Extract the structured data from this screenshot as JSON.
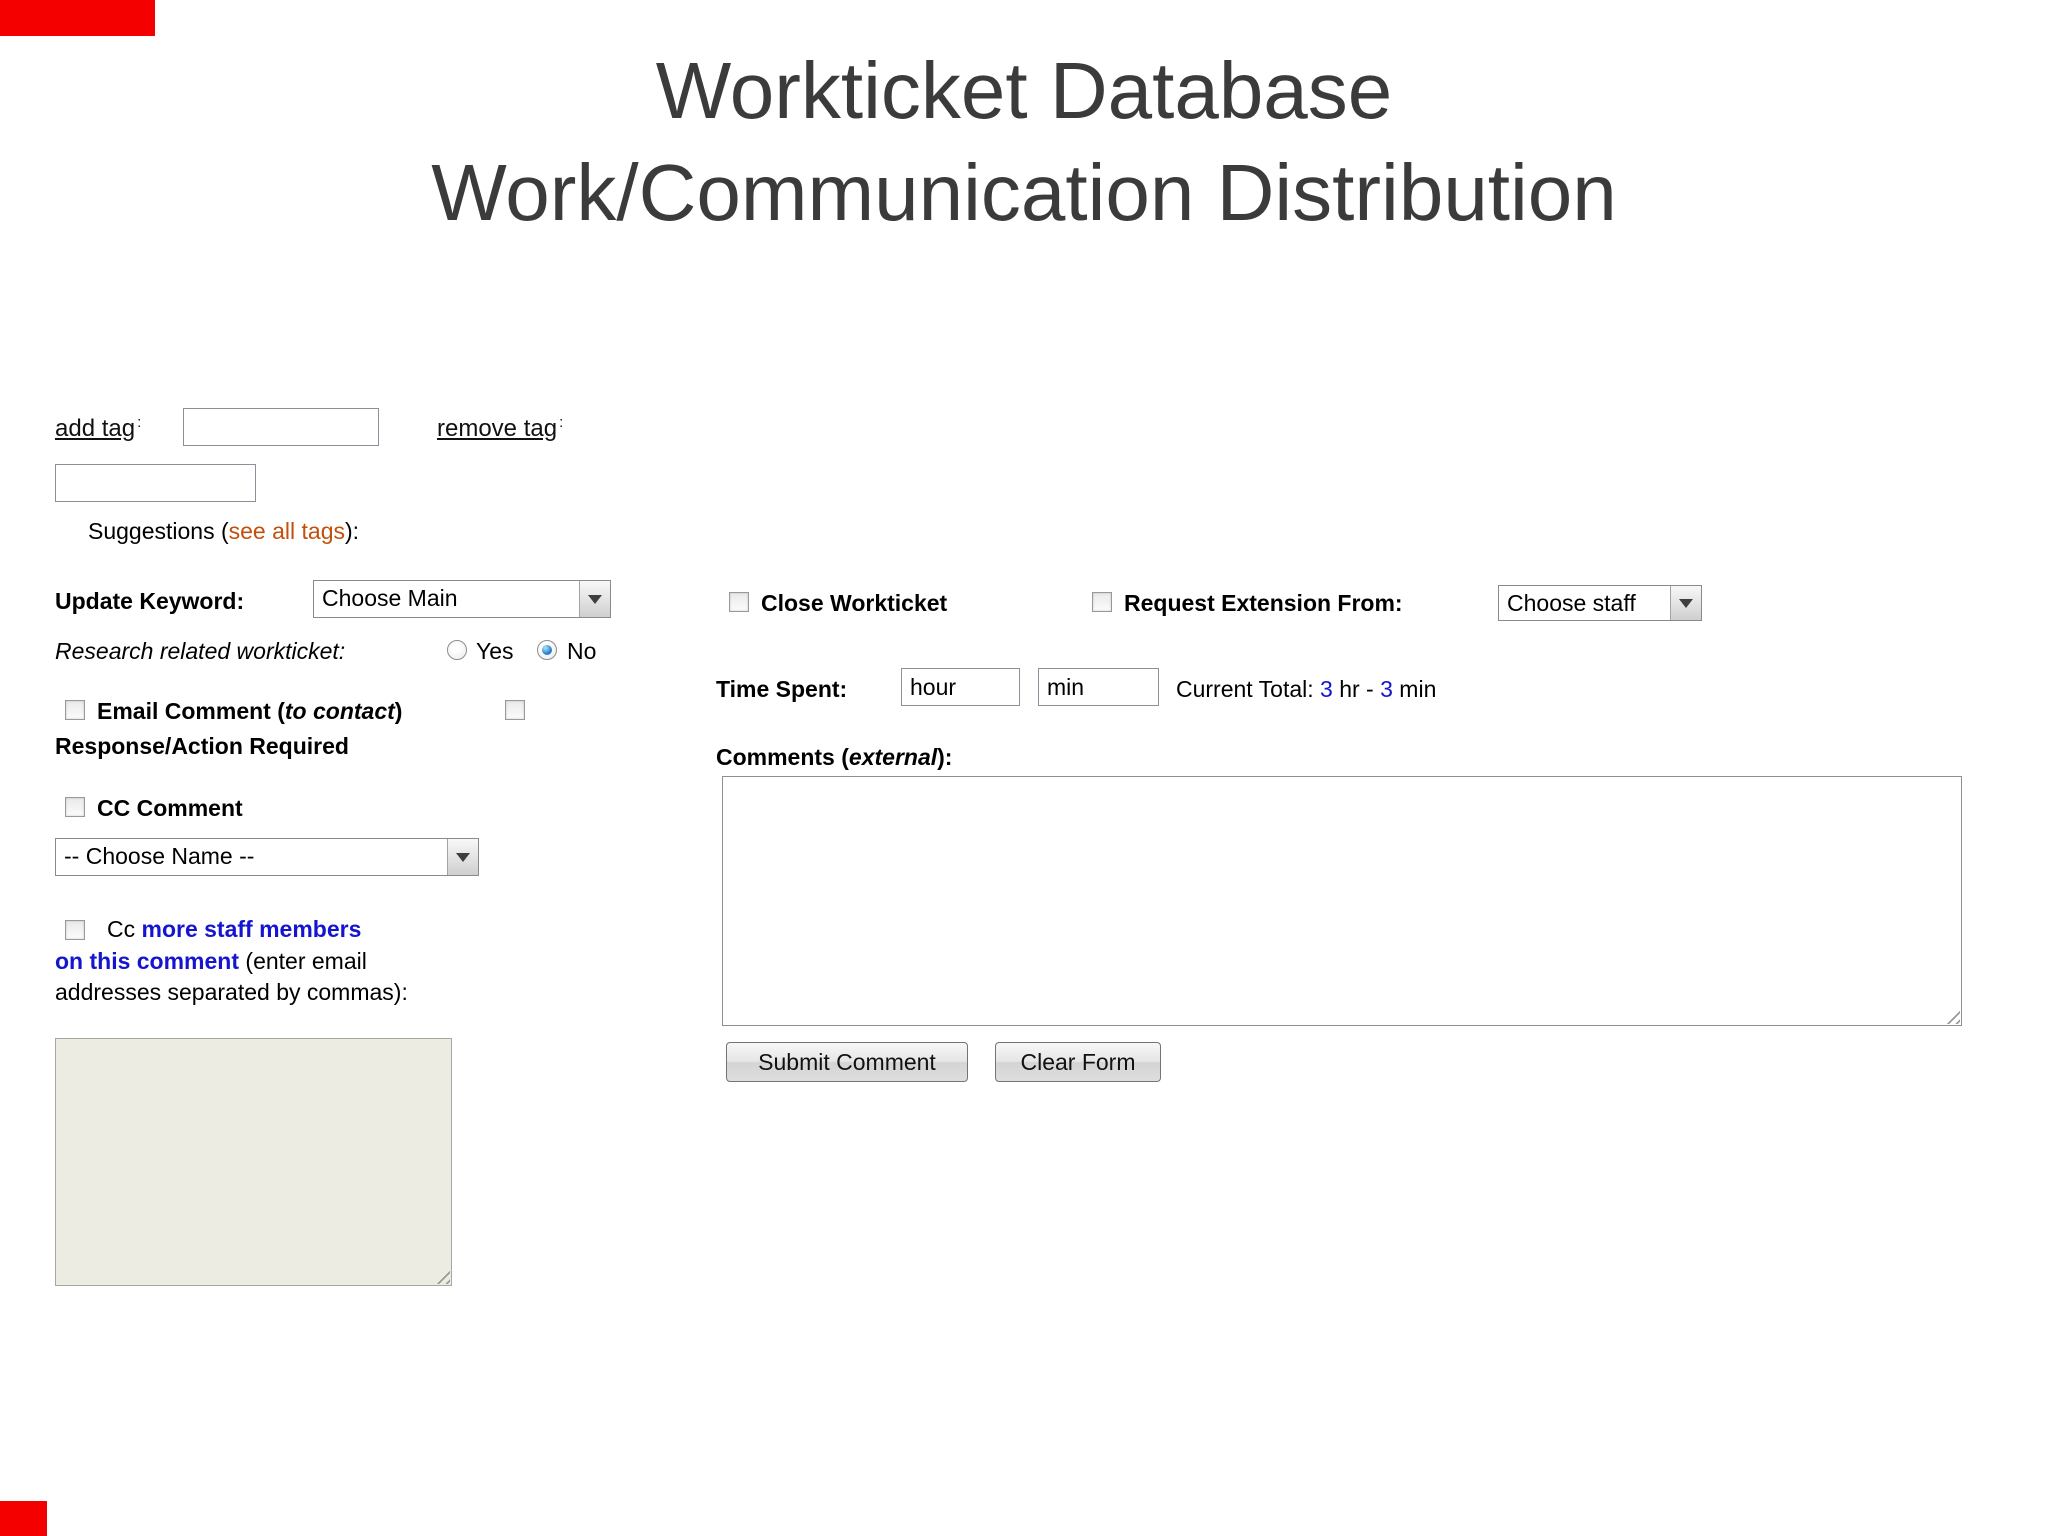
{
  "header": {
    "line1": "Workticket Database",
    "line2": "Work/Communication Distribution"
  },
  "tags": {
    "add_label": "add tag",
    "add_sup": ":",
    "remove_label": "remove tag",
    "remove_sup": ":",
    "suggestions_prefix": "Suggestions (",
    "see_all_tags": "see all tags",
    "suggestions_suffix": "):"
  },
  "keyword": {
    "label": "Update Keyword:",
    "selected": "Choose Main"
  },
  "research": {
    "label": "Research related workticket:",
    "yes": "Yes",
    "no": "No",
    "selected": "No"
  },
  "email": {
    "bold_prefix": "Email Comment (",
    "italic": "to contact",
    "bold_suffix": ")",
    "response": "Response/Action Required"
  },
  "cc": {
    "label": "CC Comment",
    "select_value": "-- Choose Name --"
  },
  "ccmore": {
    "cc_prefix": "Cc ",
    "link1": "more staff members",
    "link2": "on this comment",
    "after_link": " (enter email",
    "line3": "addresses separated by commas):"
  },
  "close": {
    "label": "Close Workticket"
  },
  "extension": {
    "label": "Request Extension From:",
    "select_value": "Choose staff"
  },
  "time": {
    "label": "Time Spent:",
    "hour_value": "hour",
    "min_value": "min",
    "total_prefix": "Current Total: ",
    "hr_num": "3",
    "hr_text": " hr - ",
    "min_num": "3",
    "min_text": " min"
  },
  "comments": {
    "bold_prefix": "Comments (",
    "italic": "external",
    "bold_suffix": "):"
  },
  "actions": {
    "submit": "Submit Comment",
    "clear": "Clear Form"
  },
  "colors": {
    "accent_red": "#f40000",
    "link_blue": "#1515d0",
    "tag_orange": "#c2500b"
  }
}
